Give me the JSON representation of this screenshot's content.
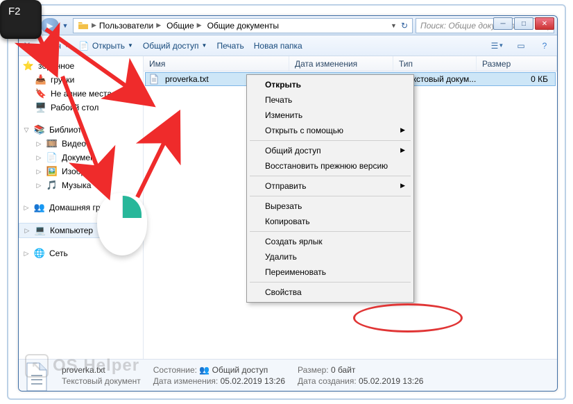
{
  "key_overlay": "F2",
  "window_controls": {
    "min": "─",
    "max": "□",
    "close": "✕"
  },
  "nav": {
    "back": "◀",
    "forward": "▶",
    "dropdown": "▼",
    "refresh": "↻",
    "crumb_dd": "▼"
  },
  "breadcrumbs": [
    "Пользователи",
    "Общие",
    "Общие документы"
  ],
  "search_placeholder": "Поиск: Общие документы",
  "toolbar": {
    "organize": "Упорядоч",
    "open": "Открыть",
    "share": "Общий доступ",
    "print": "Печать",
    "newfolder": "Новая папка"
  },
  "columns": {
    "name": "Имя",
    "date": "Дата изменения",
    "type": "Тип",
    "size": "Размер"
  },
  "file": {
    "name": "proverka.txt",
    "date": "",
    "type": "екстовый докум...",
    "size": "0 КБ"
  },
  "sidebar": {
    "fav_head": "збранное",
    "fav_items": [
      "грузки",
      "Не авние места",
      "Рабоий стол"
    ],
    "lib_head": "Библиот",
    "lib_items": [
      "Видео",
      "Докумен",
      "Изображ",
      "Музыка"
    ],
    "homegroup": "Домашняя группа",
    "computer": "Компьютер",
    "network": "Сеть"
  },
  "context_menu": {
    "open": "Открыть",
    "print": "Печать",
    "edit": "Изменить",
    "open_with": "Открыть с помощью",
    "share": "Общий доступ",
    "restore": "Восстановить прежнюю версию",
    "send_to": "Отправить",
    "cut": "Вырезать",
    "copy": "Копировать",
    "shortcut": "Создать ярлык",
    "delete": "Удалить",
    "rename": "Переименовать",
    "properties": "Свойства"
  },
  "status": {
    "filename": "proverka.txt",
    "filetype": "Текстовый документ",
    "state_label": "Состояние:",
    "state_value": "Общий доступ",
    "modified_label": "Дата изменения:",
    "modified_value": "05.02.2019 13:26",
    "size_label": "Размер:",
    "size_value": "0 байт",
    "created_label": "Дата создания:",
    "created_value": "05.02.2019 13:26"
  },
  "watermark": "OS Helper"
}
